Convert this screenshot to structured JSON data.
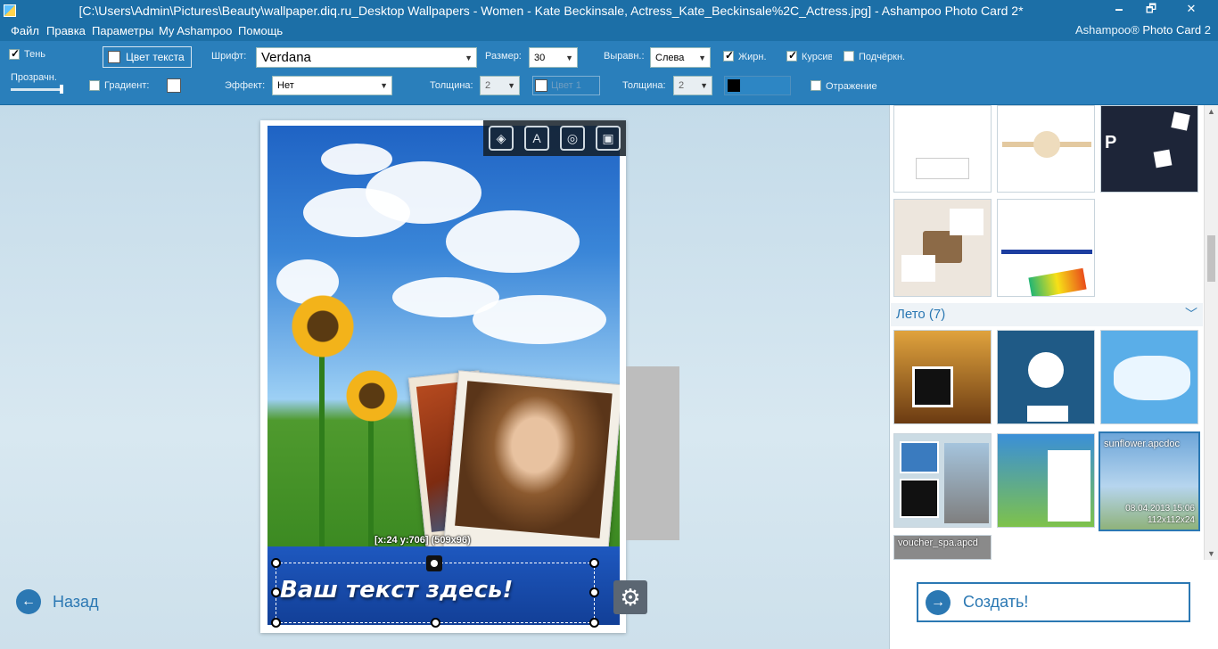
{
  "window": {
    "title": "[C:\\Users\\Admin\\Pictures\\Beauty\\wallpaper.diq.ru_Desktop Wallpapers - Women - Kate Beckinsale, Actress_Kate_Beckinsale%2C_Actress.jpg] - Ashampoo Photo Card 2*",
    "min": "🗕",
    "max": "🗗",
    "close": "✕"
  },
  "menu": {
    "file": "Файл",
    "edit": "Правка",
    "params": "Параметры",
    "my": "My Ashampoo",
    "help": "Помощь",
    "brand_prefix": "Ashampoo®",
    "brand_name": "Photo Card",
    "brand_version": "2"
  },
  "toolbar": {
    "shadow": "Тень",
    "opacity": "Прозрачн.",
    "gradient": "Градиент:",
    "text_color": "Цвет текста",
    "font_label": "Шрифт:",
    "font_value": "Verdana",
    "effect_label": "Эффект:",
    "effect_value": "Нет",
    "size_label": "Размер:",
    "size_value": "30",
    "thickness_label": "Толщина:",
    "thickness_value": "2",
    "color_label": "Цвет 1",
    "align_label": "Выравн.:",
    "align_value": "Слева",
    "thickness2_label": "Толщина:",
    "thickness2_value": "2",
    "bold": "Жирн.",
    "italic": "Курсив",
    "underline": "Подчёркн.",
    "reflection": "Отражение"
  },
  "canvas": {
    "card_text": "Ваш текст здесь!",
    "coords": "[x:24 y:706] (509x96)",
    "back": "Назад"
  },
  "panel": {
    "section_title": "Лето (7)",
    "selected_thumb": {
      "name": "sunflower.apcdoc",
      "date": "08.04.2013 15:06",
      "size": "112x112x24"
    },
    "voucher": "voucher_spa.apcd",
    "create": "Создать!"
  },
  "colors": {
    "accent": "#2b78b3",
    "titlebar": "#1c6fa7",
    "toolbar": "#2a7fbb"
  }
}
